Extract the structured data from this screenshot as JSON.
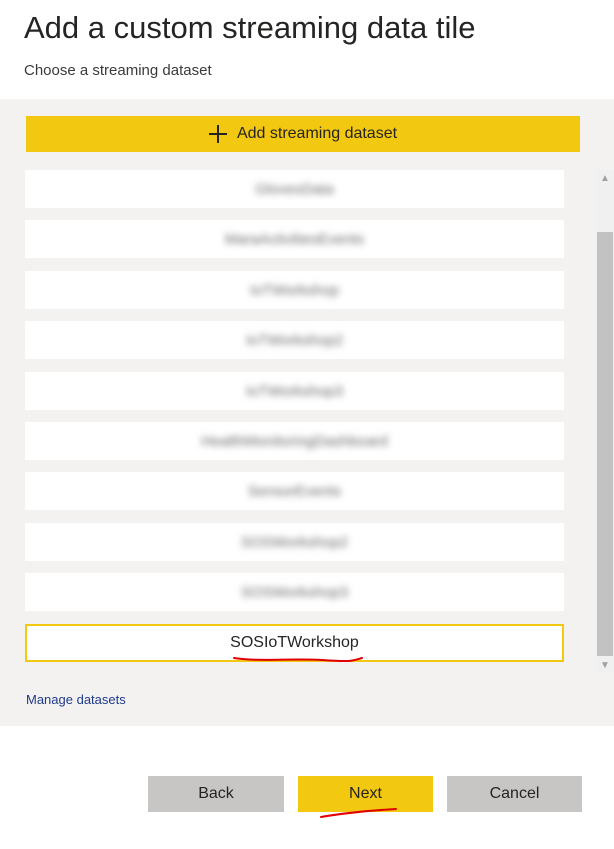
{
  "header": {
    "title": "Add a custom streaming data tile",
    "subtitle": "Choose a streaming dataset"
  },
  "add_dataset": {
    "label": "Add streaming dataset",
    "icon": "plus-icon"
  },
  "datasets": [
    {
      "label": "GlovesData"
    },
    {
      "label": "MaraActivitiesEvents"
    },
    {
      "label": "IoTWorkshop"
    },
    {
      "label": "IoTWorkshop2"
    },
    {
      "label": "IoTWorkshop3"
    },
    {
      "label": "HealthMonitoringDashboard"
    },
    {
      "label": "SensorEvents"
    },
    {
      "label": "SOSWorkshop2"
    },
    {
      "label": "SOSWorkshop3"
    }
  ],
  "selected_dataset": {
    "label": "SOSIoTWorkshop"
  },
  "manage_link": "Manage datasets",
  "footer": {
    "back": "Back",
    "next": "Next",
    "cancel": "Cancel"
  },
  "colors": {
    "accent": "#f2c811",
    "panel": "#f3f2f1",
    "secondary_button": "#c8c6c4",
    "annotation": "#e00000"
  }
}
